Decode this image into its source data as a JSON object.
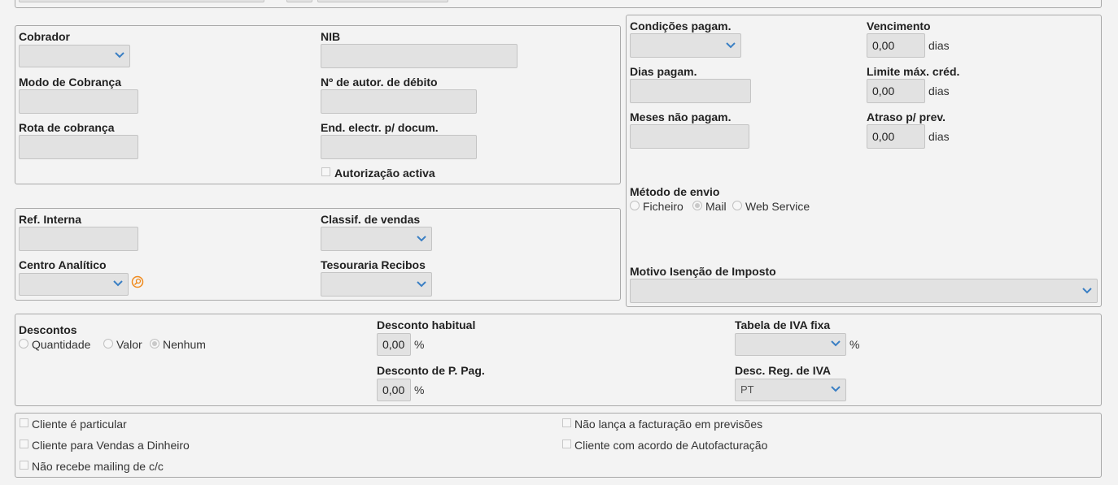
{
  "colors": {
    "background": "#f3f3f3",
    "field": "#e2e2e2",
    "border": "#a9a9a9",
    "chevron": "#3a7fc4",
    "search_icon": "#f08a1c"
  },
  "cobranca": {
    "cobrador_label": "Cobrador",
    "nib_label": "NIB",
    "modo_label": "Modo de Cobrança",
    "autor_label": "Nº de autor. de débito",
    "rota_label": "Rota de cobrança",
    "end_label": "End. electr. p/ docum.",
    "autorizacao_label": "Autorização activa"
  },
  "interno": {
    "ref_label": "Ref. Interna",
    "classif_label": "Classif. de vendas",
    "centro_label": "Centro Analítico",
    "tesouraria_label": "Tesouraria Recibos"
  },
  "pagamento": {
    "condicoes_label": "Condições pagam.",
    "vencimento_label": "Vencimento",
    "vencimento_value": "0,00",
    "dias_pagam_label": "Dias pagam.",
    "limite_label": "Limite máx. créd.",
    "limite_value": "0,00",
    "meses_label": "Meses não pagam.",
    "atraso_label": "Atraso p/ prev.",
    "atraso_value": "0,00",
    "dias_unit": "dias",
    "metodo_label": "Método de envio",
    "metodo_options": [
      "Ficheiro",
      "Mail",
      "Web Service"
    ],
    "metodo_selected": "Mail",
    "motivo_label": "Motivo Isenção de Imposto"
  },
  "descontos": {
    "label": "Descontos",
    "options": [
      "Quantidade",
      "Valor",
      "Nenhum"
    ],
    "selected": "Nenhum",
    "habitual_label": "Desconto habitual",
    "habitual_value": "0,00",
    "ppag_label": "Desconto de P. Pag.",
    "ppag_value": "0,00",
    "percent": "%",
    "iva_fixa_label": "Tabela de IVA fixa",
    "reg_iva_label": "Desc. Reg. de IVA",
    "reg_iva_value": "PT"
  },
  "flags": {
    "particular": "Cliente é particular",
    "dinheiro": "Cliente para Vendas a Dinheiro",
    "mailing": "Não recebe mailing de c/c",
    "previsoes": "Não lança a facturação em previsões",
    "autofacturacao": "Cliente com acordo de Autofacturação"
  }
}
